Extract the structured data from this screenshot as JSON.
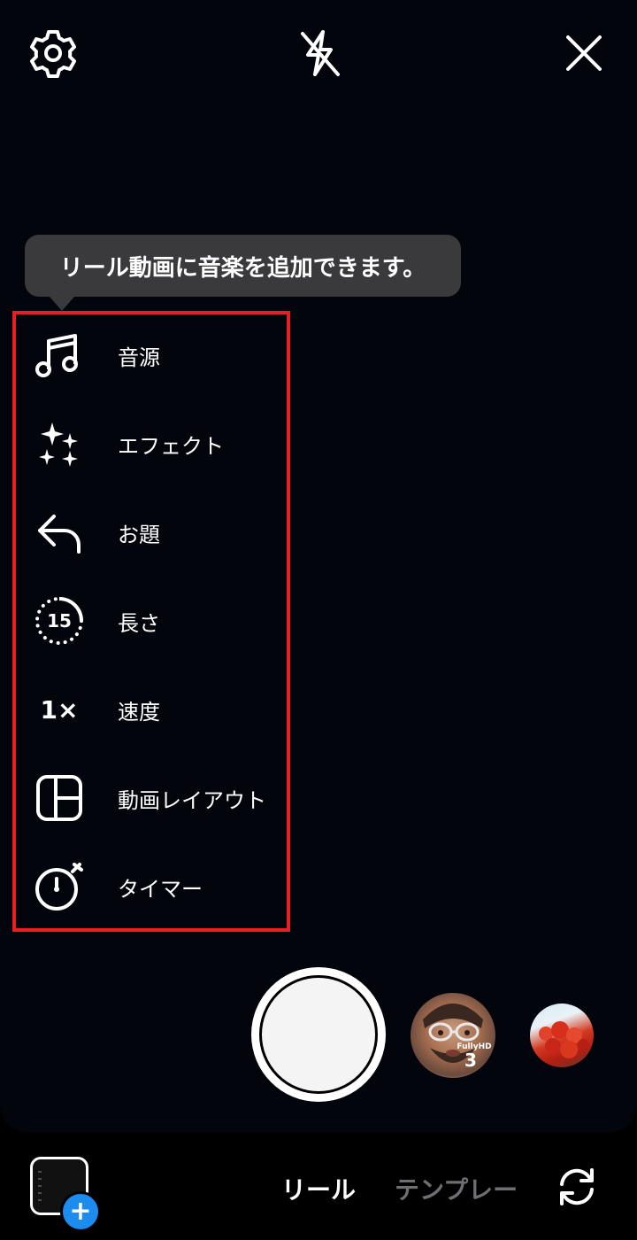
{
  "header": {
    "settings_icon": "gear-icon",
    "flash_icon": "flash-off-icon",
    "close_icon": "close-icon"
  },
  "tooltip": {
    "text": "リール動画に音楽を追加できます。"
  },
  "tools": [
    {
      "label": "音源",
      "icon": "music-note-icon"
    },
    {
      "label": "エフェクト",
      "icon": "sparkles-icon"
    },
    {
      "label": "お題",
      "icon": "reply-arrow-icon"
    },
    {
      "label": "長さ",
      "icon": "duration-icon",
      "icon_text": "15"
    },
    {
      "label": "速度",
      "icon": "speed-icon",
      "icon_text": "1×"
    },
    {
      "label": "動画レイアウト",
      "icon": "layout-grid-icon"
    },
    {
      "label": "タイマー",
      "icon": "timer-icon"
    }
  ],
  "effect_badge": {
    "name": "FullyHD",
    "count": "3"
  },
  "mode_tabs": {
    "active": "リール",
    "next": "テンプレー"
  },
  "colors": {
    "highlight": "#e81e25",
    "tooltip_bg": "#3a3a3d",
    "gallery_plus": "#1d8cf0"
  }
}
